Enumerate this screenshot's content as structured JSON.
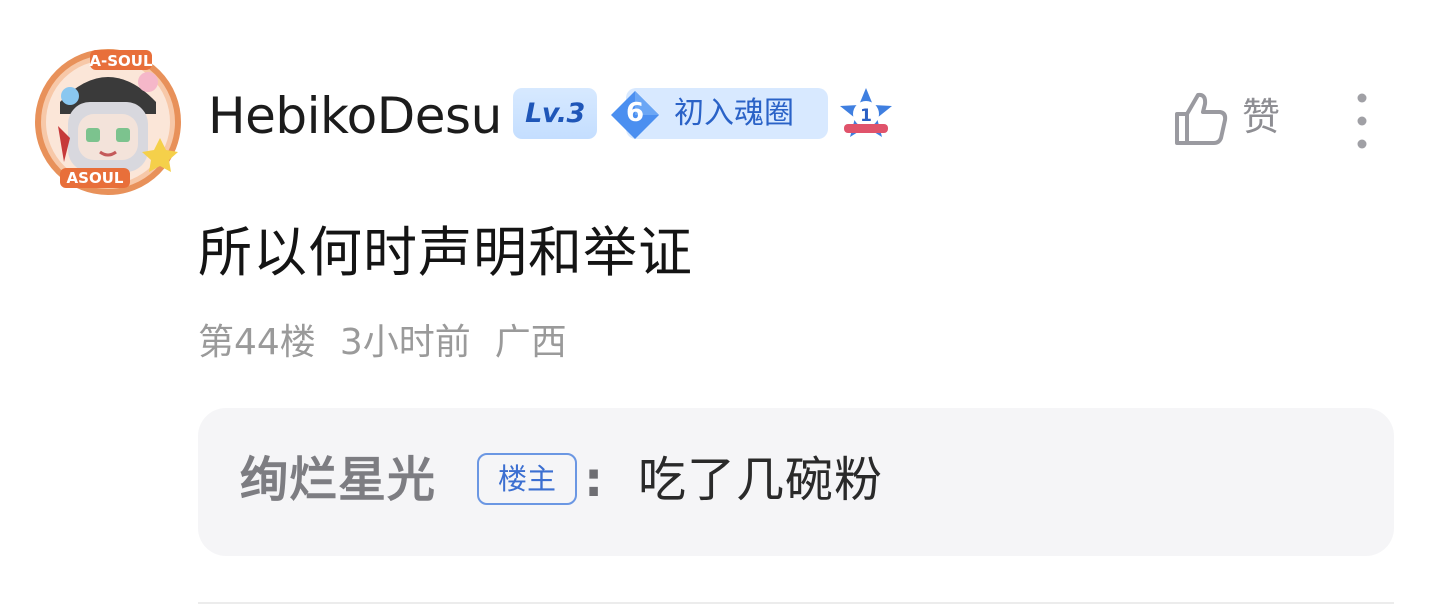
{
  "comment": {
    "author": {
      "username": "HebikoDesu",
      "level": "Lv.3",
      "fan_badge": {
        "level": "6",
        "title": "初入魂圈"
      },
      "rank_badge": "1",
      "avatar_icon": "avatar-asoul-fan-icon"
    },
    "content": "所以何时声明和举证",
    "meta": {
      "floor": "第44楼",
      "time": "3小时前",
      "location": "广西"
    },
    "actions": {
      "like_label": "赞",
      "like_icon": "thumbs-up-icon",
      "more_icon": "more-vertical-icon"
    },
    "quoted_reply": {
      "author": "绚烂星光",
      "author_tag": "楼主",
      "separator": ":",
      "text": "吃了几碗粉"
    }
  },
  "colors": {
    "level_badge_bg": "#c4deff",
    "level_badge_text": "#1f56b8",
    "fan_badge_bg": "#d8e9ff",
    "fan_badge_diamond": "#4b8ff0",
    "op_tag_border": "#6b97e3",
    "meta_text": "#9a9a9a",
    "reply_bg": "#f5f5f7"
  }
}
